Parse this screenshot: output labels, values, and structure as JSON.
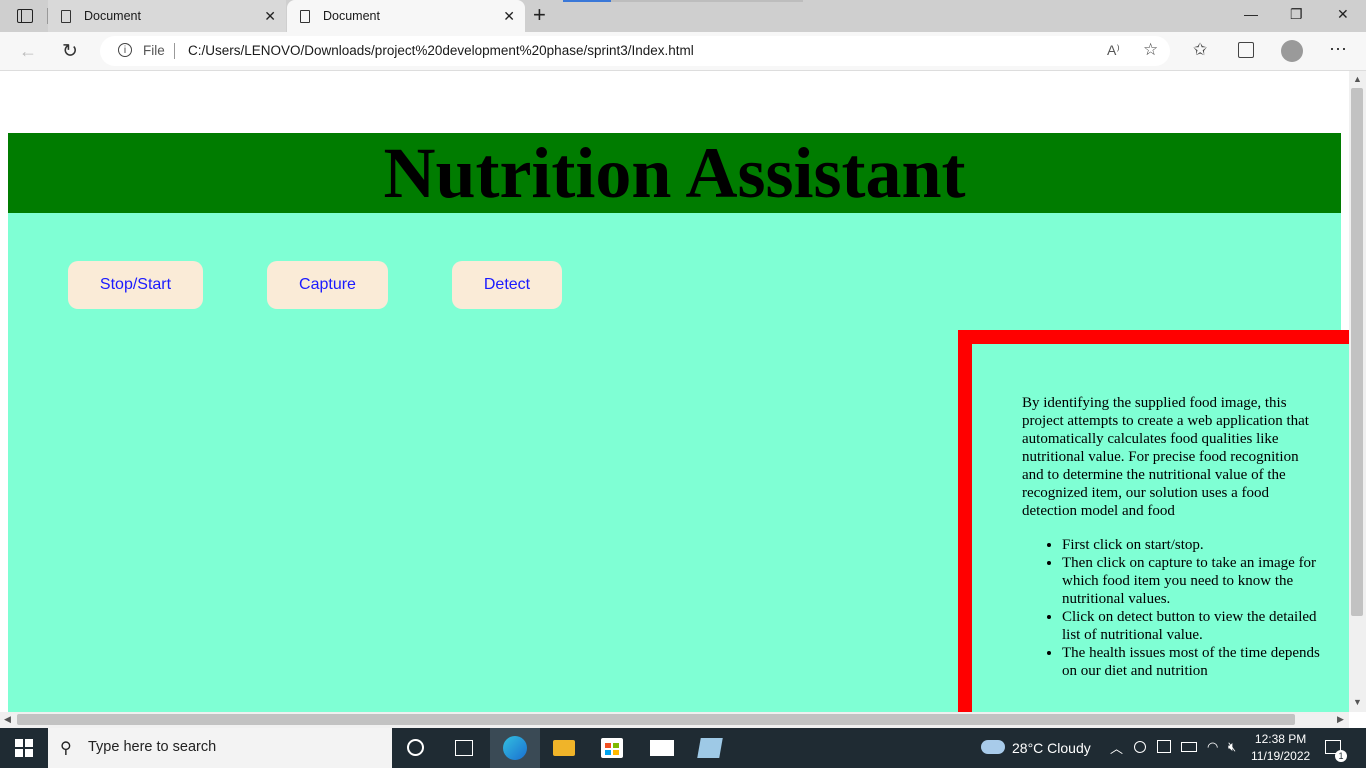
{
  "browser": {
    "tabs": [
      {
        "label": "Document",
        "active": false
      },
      {
        "label": "Document",
        "active": true
      }
    ],
    "new_tab": "+",
    "window_controls": {
      "minimize": "—",
      "restore": "❐",
      "close": "✕"
    },
    "address": {
      "protocol_label": "File",
      "url": "C:/Users/LENOVO/Downloads/project%20development%20phase/sprint3/Index.html"
    },
    "read_aloud": "A⁾",
    "menu": "⋯"
  },
  "page": {
    "title": "Nutrition Assistant",
    "buttons": [
      {
        "label": "Stop/Start"
      },
      {
        "label": "Capture"
      },
      {
        "label": "Detect"
      }
    ],
    "description": "By identifying the supplied food image, this project attempts to create a web application that automatically calculates food qualities like nutritional value. For precise food recognition and to determine the nutritional value of the recognized item, our solution uses a food detection model and food",
    "instructions": [
      "First click on start/stop.",
      "Then click on capture to take an image for which food item you need to know the nutritional values.",
      "Click on detect button to view the detailed list of nutritional value.",
      "The health issues most of the time depends on our diet and nutrition"
    ],
    "colors": {
      "header_bg": "#007c00",
      "main_bg": "#7fffd4",
      "button_bg": "#faebd7",
      "button_text": "#1a1aff",
      "info_border": "#ff0000"
    }
  },
  "taskbar": {
    "search_placeholder": "Type here to search",
    "weather": {
      "temp": "28°C",
      "condition": "Cloudy"
    },
    "time": "12:38 PM",
    "date": "11/19/2022",
    "notification_count": "1"
  }
}
